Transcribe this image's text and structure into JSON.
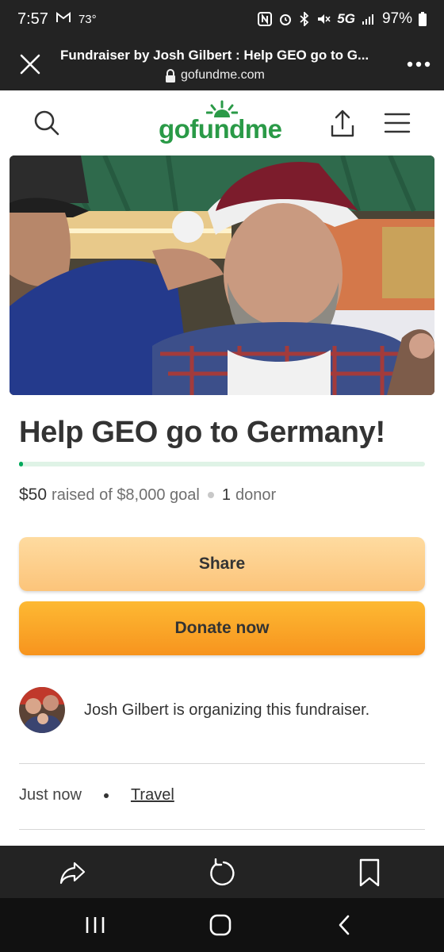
{
  "status_bar": {
    "time": "7:57",
    "temperature": "73°",
    "network": "5G",
    "battery": "97%"
  },
  "browser": {
    "page_title": "Fundraiser by Josh Gilbert : Help GEO go to G...",
    "url": "gofundme.com"
  },
  "header": {
    "logo_text": "gofundme"
  },
  "campaign": {
    "title": "Help GEO go to Germany!",
    "raised_amount": "$50",
    "raised_text": "raised of $8,000 goal",
    "donor_count": "1",
    "donor_label": "donor",
    "progress_fraction": 0.00625
  },
  "buttons": {
    "share_label": "Share",
    "donate_label": "Donate now"
  },
  "organizer": {
    "text": "Josh Gilbert is organizing this fundraiser."
  },
  "meta": {
    "created": "Just now",
    "category": "Travel"
  },
  "colors": {
    "brand_green": "#02a95c",
    "donate_orange": "#f7941e",
    "share_peach": "#fdd197",
    "chrome_dark": "#232323"
  },
  "icons": {
    "close": "close-icon",
    "lock": "lock-icon",
    "more": "more-vertical-icon",
    "search": "search-icon",
    "share": "share-upload-icon",
    "menu": "hamburger-menu-icon",
    "forward_share": "share-forward-icon",
    "reload": "reload-icon",
    "bookmark": "bookmark-icon",
    "recents": "recent-apps-icon",
    "home": "home-icon",
    "back": "back-icon"
  }
}
